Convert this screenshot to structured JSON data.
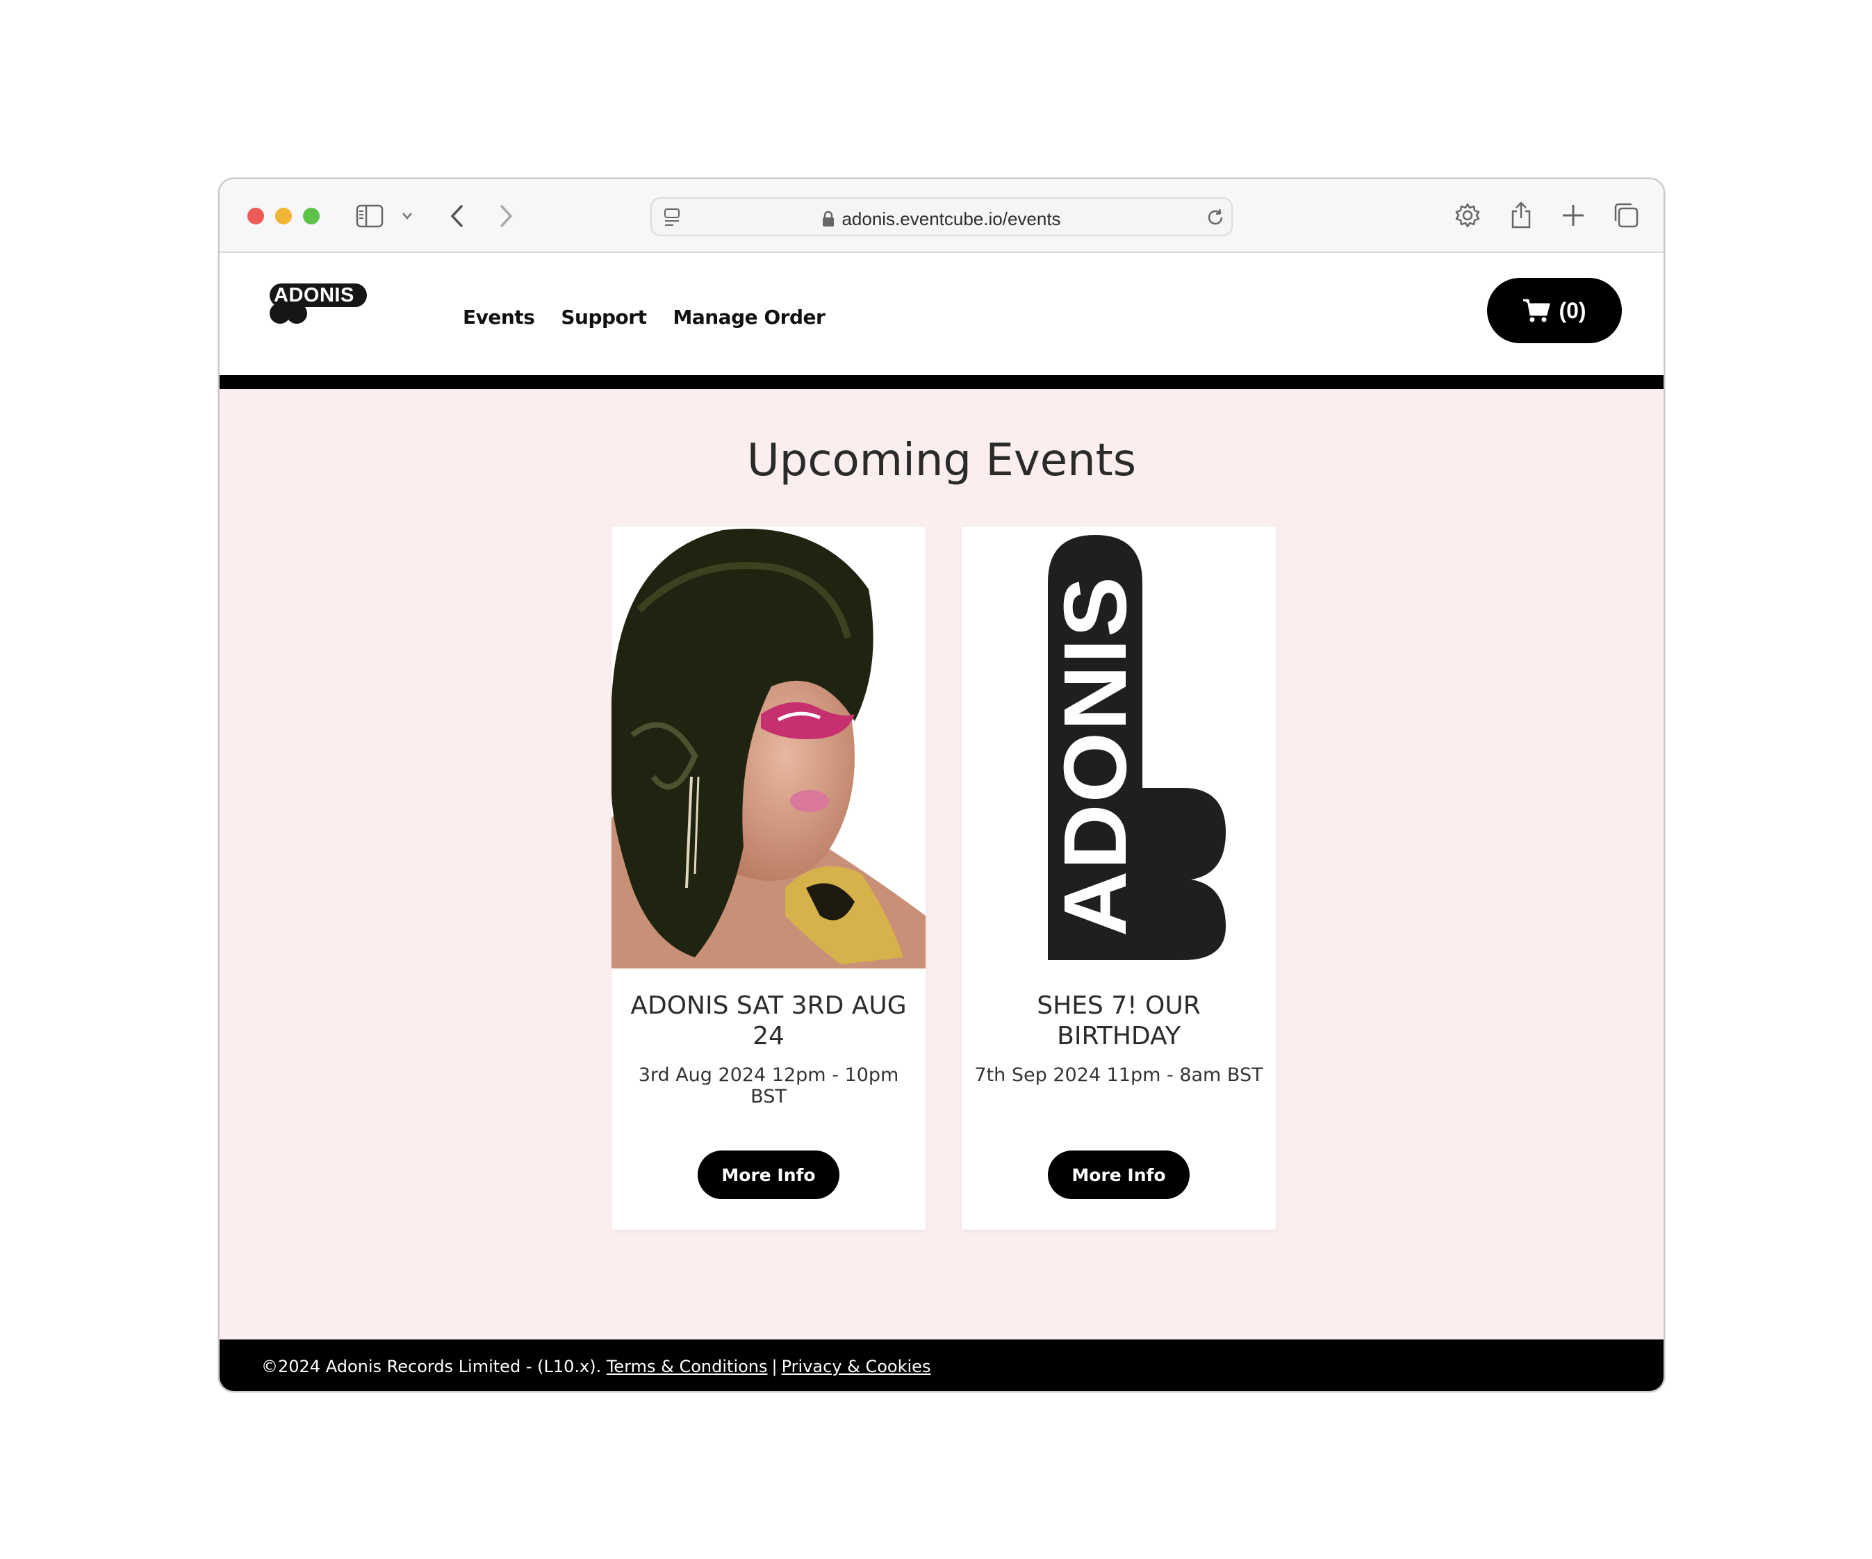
{
  "browser": {
    "url_text": "adonis.eventcube.io/events",
    "icons": [
      "sidebar-icon",
      "chevron-down-icon",
      "back-icon",
      "forward-icon",
      "reader-icon",
      "lock-icon",
      "reload-icon",
      "settings-icon",
      "share-icon",
      "new-tab-icon",
      "tabs-overview-icon"
    ]
  },
  "header": {
    "logo_text": "ADONIS",
    "nav": [
      {
        "label": "Events"
      },
      {
        "label": "Support"
      },
      {
        "label": "Manage Order"
      }
    ],
    "cart_label": "(0)"
  },
  "main": {
    "title": "Upcoming Events",
    "events": [
      {
        "title": "ADONIS SAT 3RD AUG 24",
        "date": "3rd Aug 2024 12pm - 10pm BST",
        "button_label": "More Info",
        "image": "portrait-photo"
      },
      {
        "title": "SHES 7! OUR BIRTHDAY",
        "date": "7th Sep 2024 11pm - 8am BST",
        "button_label": "More Info",
        "image_text": "ADONIS"
      }
    ]
  },
  "footer": {
    "copyright": "©2024 Adonis Records Limited - (L10.x).",
    "terms_label": "Terms & Conditions",
    "separator": "|",
    "privacy_label": "Privacy & Cookies"
  },
  "colors": {
    "page_background": "#fbeeee",
    "header_bar": "#000000",
    "button_background": "#000000",
    "footer_background": "#000000"
  }
}
